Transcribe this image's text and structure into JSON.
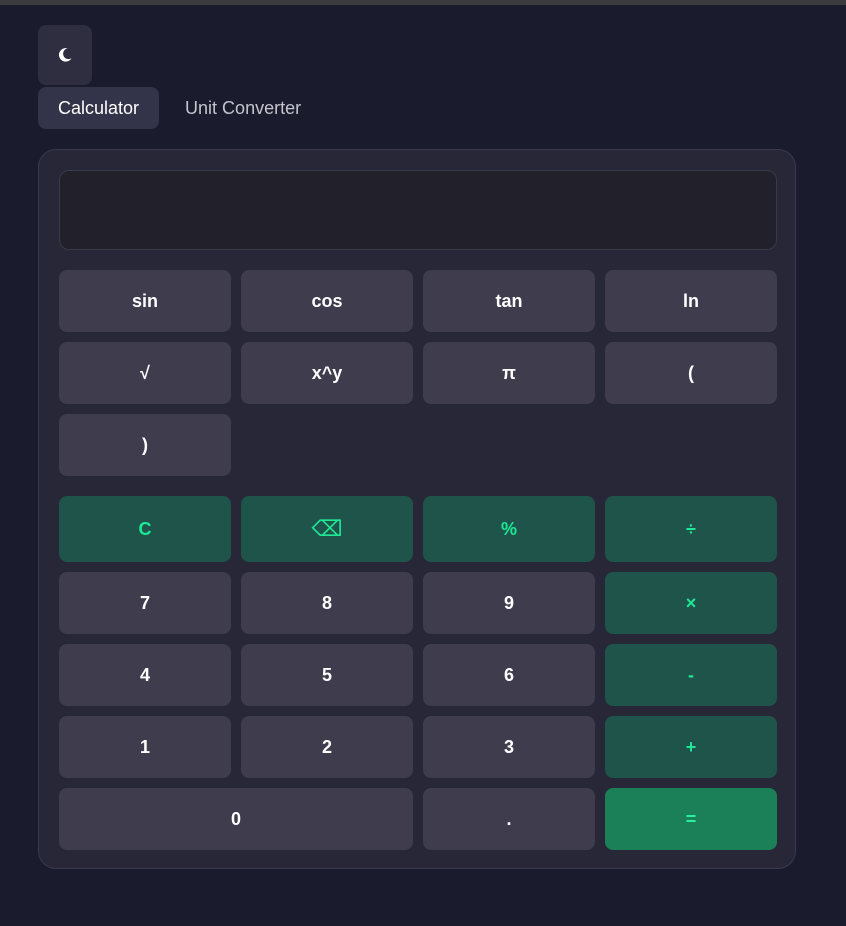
{
  "theme_toggle": {
    "icon": "moon-icon"
  },
  "tabs": [
    {
      "label": "Calculator",
      "active": true
    },
    {
      "label": "Unit Converter",
      "active": false
    }
  ],
  "display": {
    "value": ""
  },
  "scientific": {
    "sin": "sin",
    "cos": "cos",
    "tan": "tan",
    "ln": "ln",
    "sqrt": "√",
    "power": "x^y",
    "pi": "π",
    "open_paren": "(",
    "close_paren": ")"
  },
  "keypad": {
    "clear": "C",
    "backspace": "⌫",
    "percent": "%",
    "divide": "÷",
    "seven": "7",
    "eight": "8",
    "nine": "9",
    "multiply": "×",
    "four": "4",
    "five": "5",
    "six": "6",
    "subtract": "-",
    "one": "1",
    "two": "2",
    "three": "3",
    "add": "+",
    "zero": "0",
    "decimal": ".",
    "equals": "="
  },
  "colors": {
    "background": "#1b1b2e",
    "panel": "#272737",
    "key": "#3e3c4d",
    "operator_key": "#1f544a",
    "operator_text": "#1ee896",
    "equals_key": "#1b7f57"
  }
}
